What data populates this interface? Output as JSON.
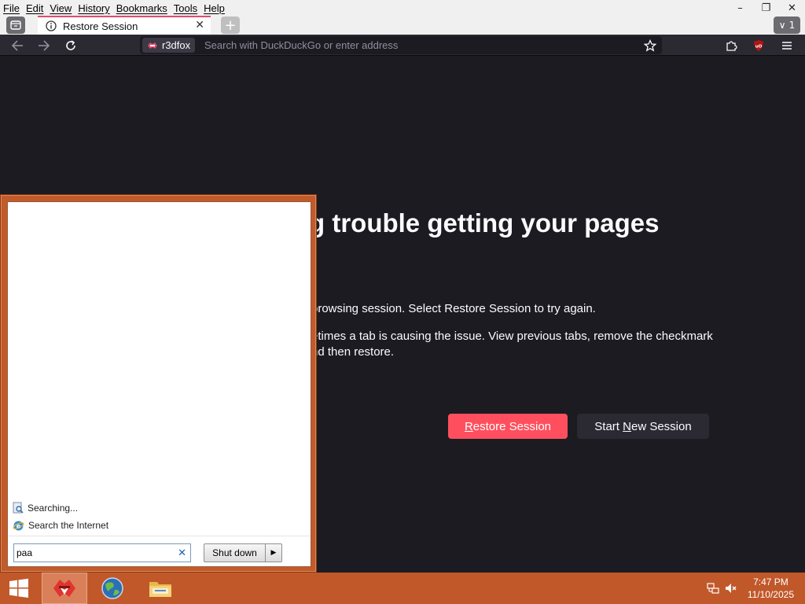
{
  "menubar": {
    "items": [
      "File",
      "Edit",
      "View",
      "History",
      "Bookmarks",
      "Tools",
      "Help"
    ]
  },
  "window": {
    "minimize": "–",
    "restore": "❐",
    "close": "✕"
  },
  "tabs": {
    "active_title": "Restore Session",
    "tab_count": "1"
  },
  "toolbar": {
    "identity_label": "r3dfox",
    "url_placeholder": "Search with DuckDuckGo or enter address"
  },
  "page": {
    "heading": "g trouble getting your pages",
    "para1": "browsing session. Select Restore Session to try again.",
    "para2_line1": "etimes a tab is causing the issue. View previous tabs, remove the checkmark",
    "para2_line2": "nd then restore.",
    "restore_button": {
      "accel": "R",
      "rest": "estore Session"
    },
    "new_session_button": {
      "pre": "Start ",
      "accel": "N",
      "rest": "ew Session"
    }
  },
  "startmenu": {
    "searching": "Searching...",
    "search_internet": "Search the Internet",
    "search_value": "paa",
    "shutdown_label": "Shut down"
  },
  "taskbar": {
    "clock_time": "7:47 PM",
    "clock_date": "11/10/2025"
  },
  "colors": {
    "accent_tab": "#e24b6b",
    "restore_button": "#ff4f5e",
    "taskbar": "#c1582a",
    "page_bg": "#1c1b22"
  }
}
